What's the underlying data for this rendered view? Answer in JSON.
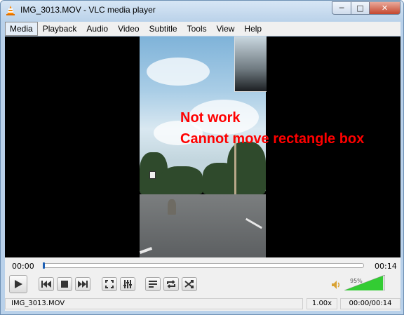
{
  "window": {
    "title": "IMG_3013.MOV - VLC media player",
    "minimize_glyph": "─",
    "maximize_glyph": "□",
    "close_glyph": "✕"
  },
  "menu": {
    "items": [
      {
        "label": "Media"
      },
      {
        "label": "Playback"
      },
      {
        "label": "Audio"
      },
      {
        "label": "Video"
      },
      {
        "label": "Subtitle"
      },
      {
        "label": "Tools"
      },
      {
        "label": "View"
      },
      {
        "label": "Help"
      }
    ]
  },
  "video": {
    "overlay_line1": "Not work",
    "overlay_line2": "Cannot move rectangle box"
  },
  "controls": {
    "elapsed": "00:00",
    "total": "00:14",
    "seek_fraction": 0.0,
    "volume_percent": "95%",
    "volume_fraction": 0.95
  },
  "statusbar": {
    "filename": "IMG_3013.MOV",
    "speed": "1.00x",
    "time": "00:00/00:14"
  },
  "colors": {
    "overlay_text": "#ff0000",
    "volume_fill": "#33cc33"
  }
}
